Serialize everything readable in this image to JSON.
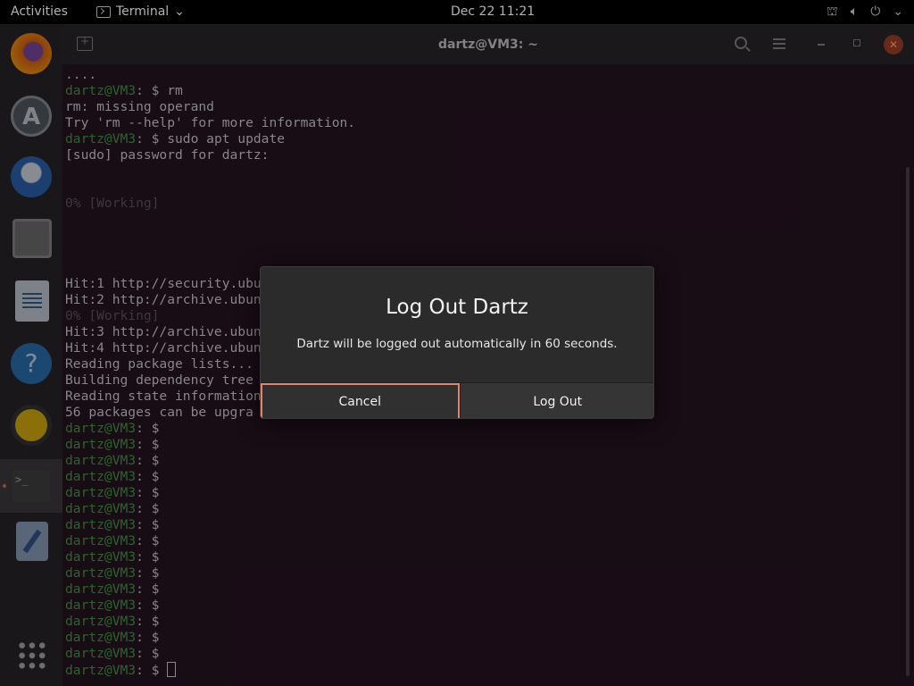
{
  "topbar": {
    "activities": "Activities",
    "app_name": "Terminal",
    "app_menu_chevron": "⌄",
    "clock": "Dec 22  11:21",
    "tray_icons": [
      "network-icon",
      "volume-icon",
      "power-icon",
      "chevron-down-icon"
    ]
  },
  "dock": {
    "items": [
      "firefox",
      "ubuntu-software",
      "thunderbird",
      "files",
      "libreoffice-writer",
      "help",
      "rhythmbox",
      "terminal",
      "text-editor",
      "show-applications"
    ]
  },
  "terminal": {
    "title": "dartz@VM3: ~",
    "lines": [
      {
        "prompt": "",
        "text": "...."
      },
      {
        "prompt": "dartz@VM3",
        "text": ": $ rm"
      },
      {
        "prompt": "",
        "text": "rm: missing operand"
      },
      {
        "prompt": "",
        "text": "Try 'rm --help' for more information."
      },
      {
        "prompt": "dartz@VM3",
        "text": ": $ sudo apt update"
      },
      {
        "prompt": "",
        "text": "[sudo] password for dartz:"
      },
      {
        "prompt": "",
        "text": ""
      },
      {
        "prompt": "",
        "text": ""
      },
      {
        "prompt": "",
        "text": "0% [Working]",
        "dim": true
      },
      {
        "prompt": "",
        "text": ""
      },
      {
        "prompt": "",
        "text": ""
      },
      {
        "prompt": "",
        "text": ""
      },
      {
        "prompt": "",
        "text": ""
      },
      {
        "prompt": "",
        "text": "Hit:1 http://security.ubu"
      },
      {
        "prompt": "",
        "text": "Hit:2 http://archive.ubun"
      },
      {
        "prompt": "",
        "text": "0% [Working]",
        "dim": true
      },
      {
        "prompt": "",
        "text": "Hit:3 http://archive.ubun"
      },
      {
        "prompt": "",
        "text": "Hit:4 http://archive.ubun"
      },
      {
        "prompt": "",
        "text": "Reading package lists..."
      },
      {
        "prompt": "",
        "text": "Building dependency tree"
      },
      {
        "prompt": "",
        "text": "Reading state information"
      },
      {
        "prompt": "",
        "text": "56 packages can be upgra"
      },
      {
        "prompt": "dartz@VM3",
        "text": ": $"
      },
      {
        "prompt": "dartz@VM3",
        "text": ": $"
      },
      {
        "prompt": "dartz@VM3",
        "text": ": $"
      },
      {
        "prompt": "dartz@VM3",
        "text": ": $"
      },
      {
        "prompt": "dartz@VM3",
        "text": ": $"
      },
      {
        "prompt": "dartz@VM3",
        "text": ": $"
      },
      {
        "prompt": "dartz@VM3",
        "text": ": $"
      },
      {
        "prompt": "dartz@VM3",
        "text": ": $"
      },
      {
        "prompt": "dartz@VM3",
        "text": ": $"
      },
      {
        "prompt": "dartz@VM3",
        "text": ": $"
      },
      {
        "prompt": "dartz@VM3",
        "text": ": $"
      },
      {
        "prompt": "dartz@VM3",
        "text": ": $"
      },
      {
        "prompt": "dartz@VM3",
        "text": ": $"
      },
      {
        "prompt": "dartz@VM3",
        "text": ": $"
      },
      {
        "prompt": "dartz@VM3",
        "text": ": $"
      },
      {
        "prompt": "dartz@VM3",
        "text": ": $",
        "cursor": true
      }
    ]
  },
  "dialog": {
    "title": "Log Out Dartz",
    "message": "Dartz will be logged out automatically in 60 seconds.",
    "cancel_label": "Cancel",
    "logout_label": "Log Out",
    "focus_color": "#e9826a"
  }
}
